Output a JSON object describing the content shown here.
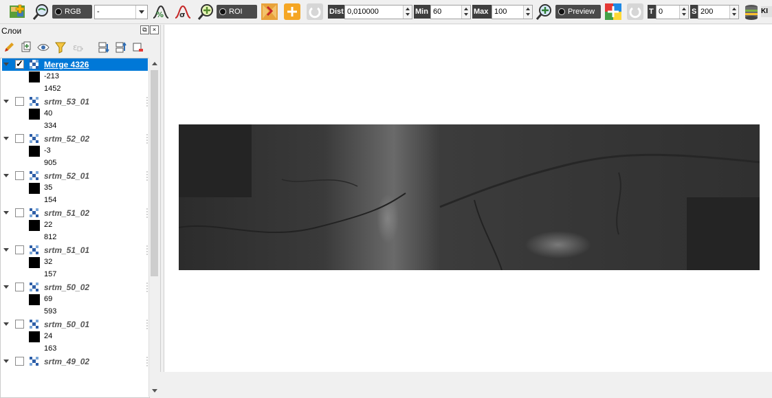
{
  "toolbar": {
    "rgb_label": "RGB",
    "band_combo_value": "-",
    "roi_label": "ROI",
    "dist_label": "Dist",
    "dist_value": "0,010000",
    "min_label": "Min",
    "min_value": "60",
    "max_label": "Max",
    "max_value": "100",
    "preview_label": "Preview",
    "t_label": "T",
    "t_value": "0",
    "s_label": "S",
    "s_value": "200",
    "ki_label": "KI"
  },
  "panel": {
    "title": "Слои",
    "float_btn": "⧉",
    "close_btn": "×"
  },
  "layers": [
    {
      "name": "Merge 4326",
      "checked": true,
      "min": "-213",
      "max": "1452"
    },
    {
      "name": "srtm_53_01",
      "checked": false,
      "min": "40",
      "max": "334"
    },
    {
      "name": "srtm_52_02",
      "checked": false,
      "min": "-3",
      "max": "905"
    },
    {
      "name": "srtm_52_01",
      "checked": false,
      "min": "35",
      "max": "154"
    },
    {
      "name": "srtm_51_02",
      "checked": false,
      "min": "22",
      "max": "812"
    },
    {
      "name": "srtm_51_01",
      "checked": false,
      "min": "32",
      "max": "157"
    },
    {
      "name": "srtm_50_02",
      "checked": false,
      "min": "69",
      "max": "593"
    },
    {
      "name": "srtm_50_01",
      "checked": false,
      "min": "24",
      "max": "163"
    },
    {
      "name": "srtm_49_02",
      "checked": false
    }
  ],
  "colors": {
    "selection": "#0078d7",
    "raster_nodata": "#242424"
  }
}
